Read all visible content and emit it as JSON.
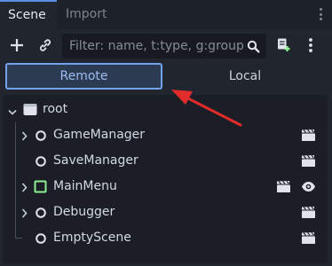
{
  "tabs": [
    {
      "label": "Scene",
      "active": true
    },
    {
      "label": "Import",
      "active": false
    }
  ],
  "toolbar": {
    "filter_placeholder": "Filter: name, t:type, g:group",
    "filter_value": ""
  },
  "modes": {
    "remote": "Remote",
    "local": "Local",
    "selected": "remote"
  },
  "tree": {
    "root": "root",
    "children": [
      {
        "label": "GameManager",
        "expandable": true,
        "icon": "node-circle-icon",
        "actions": [
          "scene-clapper-icon"
        ]
      },
      {
        "label": "SaveManager",
        "expandable": false,
        "icon": "node-circle-icon",
        "actions": [
          "scene-clapper-icon"
        ]
      },
      {
        "label": "MainMenu",
        "expandable": true,
        "icon": "control-node-icon",
        "actions": [
          "scene-clapper-icon",
          "visibility-eye-icon"
        ]
      },
      {
        "label": "Debugger",
        "expandable": true,
        "icon": "node-circle-icon",
        "actions": [
          "scene-clapper-icon"
        ]
      },
      {
        "label": "EmptyScene",
        "expandable": false,
        "icon": "node-circle-icon",
        "actions": [
          "scene-clapper-icon"
        ]
      }
    ]
  },
  "colors": {
    "accent": "#74a1ee",
    "annotation_arrow": "#e22b2b",
    "control_node": "#8eef97"
  }
}
